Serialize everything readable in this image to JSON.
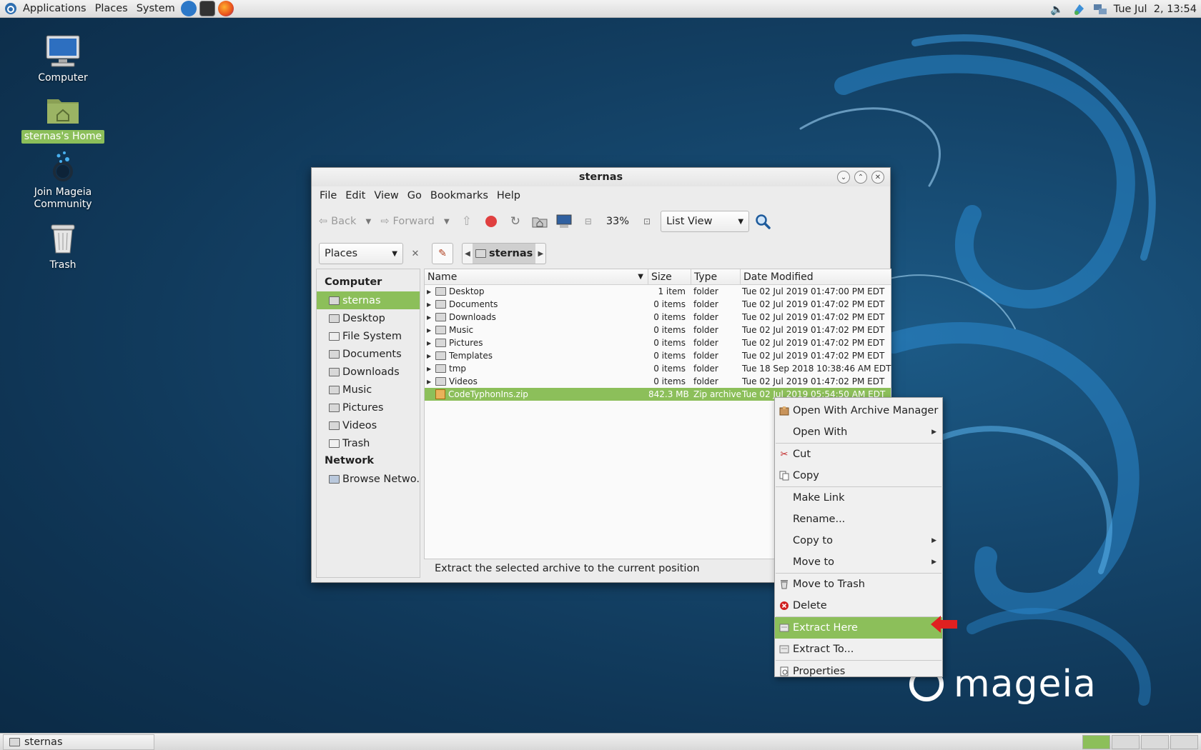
{
  "top_panel": {
    "menus": [
      "Applications",
      "Places",
      "System"
    ],
    "launchers": [
      "settings-launcher-icon",
      "terminal-launcher-icon",
      "firefox-launcher-icon"
    ],
    "clock": "Tue Jul  2, 13:54"
  },
  "desktop": {
    "icons": [
      {
        "label": "Computer"
      },
      {
        "label": "sternas's Home"
      },
      {
        "label": "Join Mageia Community"
      },
      {
        "label": "Trash"
      }
    ],
    "brand": "mageia"
  },
  "window": {
    "title": "sternas",
    "menu": [
      "File",
      "Edit",
      "View",
      "Go",
      "Bookmarks",
      "Help"
    ],
    "toolbar": {
      "back": "Back",
      "forward": "Forward",
      "zoom": "33%",
      "view_mode": "List View"
    },
    "location": {
      "places_label": "Places",
      "crumb": "sternas"
    },
    "sidebar": {
      "computer_heading": "Computer",
      "computer_items": [
        "sternas",
        "Desktop",
        "File System",
        "Documents",
        "Downloads",
        "Music",
        "Pictures",
        "Videos",
        "Trash"
      ],
      "network_heading": "Network",
      "network_items": [
        "Browse Netwo..."
      ]
    },
    "columns": {
      "name": "Name",
      "size": "Size",
      "type": "Type",
      "date": "Date Modified"
    },
    "files": [
      {
        "name": "Desktop",
        "size": "1 item",
        "type": "folder",
        "date": "Tue 02 Jul 2019 01:47:00 PM EDT"
      },
      {
        "name": "Documents",
        "size": "0 items",
        "type": "folder",
        "date": "Tue 02 Jul 2019 01:47:02 PM EDT"
      },
      {
        "name": "Downloads",
        "size": "0 items",
        "type": "folder",
        "date": "Tue 02 Jul 2019 01:47:02 PM EDT"
      },
      {
        "name": "Music",
        "size": "0 items",
        "type": "folder",
        "date": "Tue 02 Jul 2019 01:47:02 PM EDT"
      },
      {
        "name": "Pictures",
        "size": "0 items",
        "type": "folder",
        "date": "Tue 02 Jul 2019 01:47:02 PM EDT"
      },
      {
        "name": "Templates",
        "size": "0 items",
        "type": "folder",
        "date": "Tue 02 Jul 2019 01:47:02 PM EDT"
      },
      {
        "name": "tmp",
        "size": "0 items",
        "type": "folder",
        "date": "Tue 18 Sep 2018 10:38:46 AM EDT"
      },
      {
        "name": "Videos",
        "size": "0 items",
        "type": "folder",
        "date": "Tue 02 Jul 2019 01:47:02 PM EDT"
      },
      {
        "name": "CodeTyphonIns.zip",
        "size": "842.3 MB",
        "type": "Zip archive",
        "date": "Tue 02 Jul 2019 05:54:50 AM EDT"
      }
    ],
    "status": "Extract the selected archive to the current position"
  },
  "context_menu": {
    "items": [
      {
        "label": "Open With Archive Manager"
      },
      {
        "label": "Open With"
      },
      {
        "label": "Cut"
      },
      {
        "label": "Copy"
      },
      {
        "label": "Make Link"
      },
      {
        "label": "Rename..."
      },
      {
        "label": "Copy to"
      },
      {
        "label": "Move to"
      },
      {
        "label": "Move to Trash"
      },
      {
        "label": "Delete"
      },
      {
        "label": "Extract Here"
      },
      {
        "label": "Extract To..."
      },
      {
        "label": "Properties"
      }
    ]
  },
  "taskbar": {
    "task": "sternas"
  },
  "colors": {
    "selection": "#8cbf5a",
    "desktop_bg": "#15466c",
    "arrow": "#e02020"
  }
}
